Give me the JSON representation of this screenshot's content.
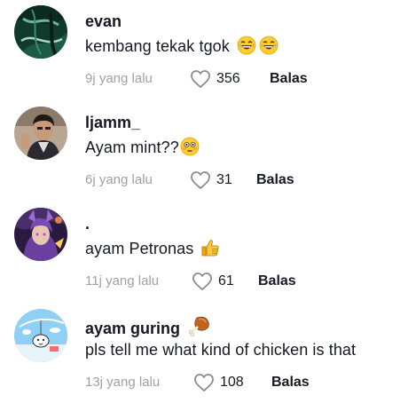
{
  "comments": [
    {
      "username": "evan",
      "text": "kembang tekak tgok",
      "emojis": [
        "grinning-sweat-emoji",
        "grinning-sweat-emoji"
      ],
      "time": "9j yang lalu",
      "likes": "356",
      "reply_label": "Balas",
      "avatar": "dark-green-marble-avatar"
    },
    {
      "username": "ljamm_",
      "text": "Ayam mint??",
      "emojis": [
        "flushed-face-emoji"
      ],
      "time": "6j yang lalu",
      "likes": "31",
      "reply_label": "Balas",
      "avatar": "person-selfie-avatar"
    },
    {
      "username": ".",
      "text": "ayam Petronas",
      "emojis": [
        "thumbs-up-emoji"
      ],
      "time": "11j yang lalu",
      "likes": "61",
      "reply_label": "Balas",
      "avatar": "purple-game-character-avatar"
    },
    {
      "username": "ayam guring",
      "username_emoji": "poultry-leg-emoji",
      "text": "pls tell me what kind of chicken is that",
      "time": "13j yang lalu",
      "likes": "108",
      "reply_label": "Balas",
      "avatar": "cartoon-sky-avatar"
    }
  ],
  "colors": {
    "text": "#161823",
    "muted": "#a0a0a8",
    "background": "#ffffff"
  }
}
